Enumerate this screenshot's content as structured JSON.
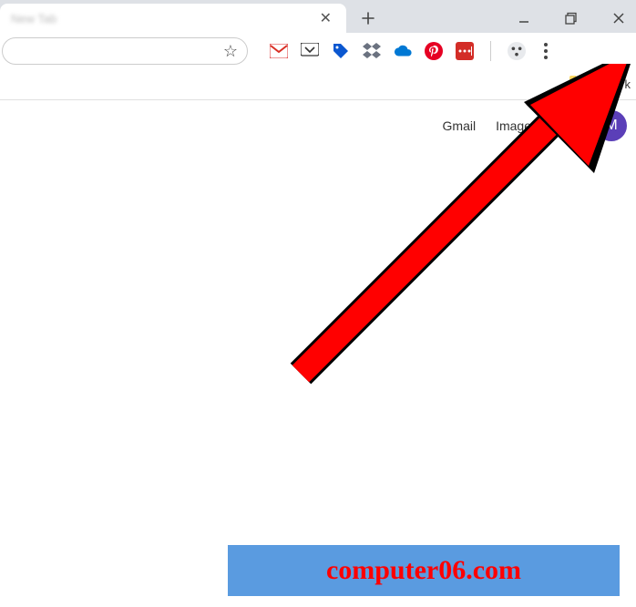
{
  "tab": {
    "title": "New Tab"
  },
  "bookmarks": {
    "other_label": "Other bookmarks",
    "other_label_visible": "O…ark"
  },
  "content": {
    "gmail": "Gmail",
    "images": "Images",
    "avatar_letter": "M"
  },
  "watermark": {
    "text": "computer06.com"
  },
  "icons": {
    "gmail": "gmail-icon",
    "pocket": "pocket-icon",
    "tag": "tag-icon",
    "dropbox": "dropbox-icon",
    "onedrive": "onedrive-icon",
    "pinterest": "pinterest-icon",
    "lastpass": "lastpass-icon",
    "profile": "profile-icon"
  }
}
